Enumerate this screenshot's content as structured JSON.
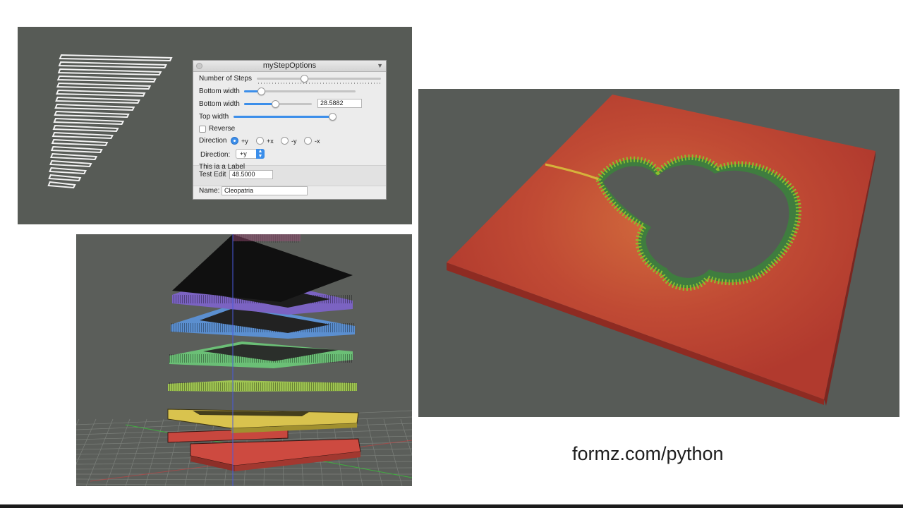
{
  "dialog": {
    "title": "myStepOptions",
    "number_of_steps_label": "Number of Steps",
    "number_of_steps_level": 0.38,
    "bottom_width_label_1": "Bottom width",
    "bottom_width_level_1": 0.15,
    "bottom_width_label_2": "Bottom width",
    "bottom_width_level_2": 0.46,
    "bottom_width_value": "28.5882",
    "top_width_label": "Top width",
    "top_width_level": 1.0,
    "reverse_label": "Reverse",
    "reverse_checked": false,
    "direction_label": "Direction",
    "direction_options": [
      "+y",
      "+x",
      "-y",
      "-x"
    ],
    "direction_selected": "+y",
    "direction_popup_label": "Direction:",
    "direction_popup_value": "+y",
    "group_label": "This ia a Label",
    "test_edit_label": "Test Edit",
    "test_edit_value": "48.5000",
    "name_label": "Name:",
    "name_value": "Cleopatria"
  },
  "caption": "formz.com/python",
  "colors": {
    "viewport_bg": "#575b56",
    "accent_blue": "#3b8eea",
    "mandel_red": "#b83c2e"
  },
  "icons": {
    "dialog_close": "close-dot-icon",
    "dialog_menu": "triangle-down-icon",
    "popup_arrows": "up-down-arrows-icon"
  }
}
